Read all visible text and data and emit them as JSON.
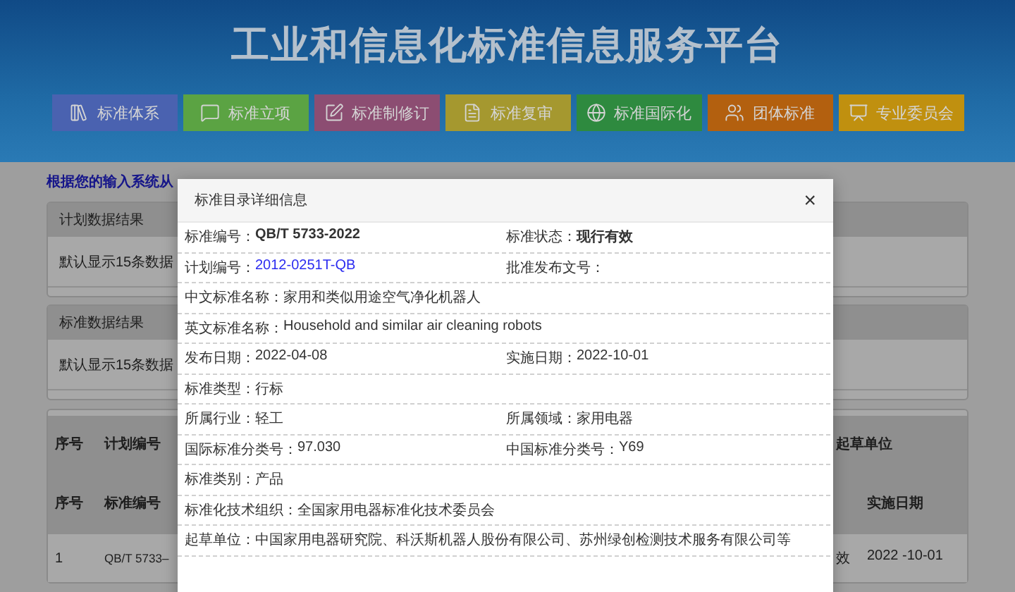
{
  "header": {
    "title": "工业和信息化标准信息服务平台"
  },
  "nav": [
    {
      "label": "标准体系",
      "color": "#4a62b0"
    },
    {
      "label": "标准立项",
      "color": "#5ba343"
    },
    {
      "label": "标准制修订",
      "color": "#8c4d72"
    },
    {
      "label": "标准复审",
      "color": "#a5982f"
    },
    {
      "label": "标准国际化",
      "color": "#2e8a3f"
    },
    {
      "label": "团体标准",
      "color": "#b3600f"
    },
    {
      "label": "专业委员会",
      "color": "#c0900f"
    }
  ],
  "intro": "根据您的输入系统从",
  "panels": [
    {
      "title": "计划数据结果",
      "note": "默认显示15条数据"
    },
    {
      "title": "标准数据结果",
      "note": "默认显示15条数据"
    }
  ],
  "plan_table": {
    "columns": [
      "序号",
      "计划编号",
      "起草单位"
    ]
  },
  "standard_table": {
    "columns": [
      "序号",
      "标准编号",
      "",
      "实施日期"
    ],
    "rows": [
      {
        "cells": [
          "1",
          "QB/T 5733–",
          "效",
          "2022 -10-01"
        ]
      }
    ]
  },
  "modal": {
    "title": "标准目录详细信息",
    "close": "×",
    "rows": [
      {
        "cells": [
          {
            "label": "标准编号：",
            "value": "QB/T 5733-2022",
            "kind": "emphasis"
          },
          {
            "label": "标准状态：",
            "value": "现行有效",
            "kind": "emphasis"
          }
        ]
      },
      {
        "cells": [
          {
            "label": "计划编号：",
            "value": "2012-0251T-QB",
            "kind": "link"
          },
          {
            "label": "批准发布文号："
          }
        ]
      },
      {
        "cells": [
          {
            "label": "中文标准名称：",
            "value": "家用和类似用途空气净化机器人",
            "kind": "plain"
          }
        ]
      },
      {
        "cells": [
          {
            "label": "英文标准名称：",
            "value": "Household and similar air cleaning robots",
            "kind": "plain"
          }
        ]
      },
      {
        "cells": [
          {
            "label": "发布日期：",
            "value": "2022-04-08",
            "kind": "plain"
          },
          {
            "label": "实施日期：",
            "value": "2022-10-01",
            "kind": "plain"
          }
        ]
      },
      {
        "cells": [
          {
            "label": "标准类型：",
            "value": "行标",
            "kind": "plain"
          }
        ]
      },
      {
        "cells": [
          {
            "label": "所属行业：",
            "value": "轻工",
            "kind": "plain"
          },
          {
            "label": "所属领域：",
            "value": "家用电器",
            "kind": "plain"
          }
        ]
      },
      {
        "cells": [
          {
            "label": "国际标准分类号：",
            "value": "97.030",
            "kind": "plain"
          },
          {
            "label": "中国标准分类号：",
            "value": "Y69",
            "kind": "plain"
          }
        ]
      },
      {
        "cells": [
          {
            "label": "标准类别：",
            "value": "产品",
            "kind": "plain"
          }
        ]
      },
      {
        "cells": [
          {
            "label": "标准化技术组织：",
            "value": "全国家用电器标准化技术委员会",
            "kind": "plain"
          }
        ]
      },
      {
        "cells": [
          {
            "label": "起草单位：",
            "value": "中国家用电器研究院、科沃斯机器人股份有限公司、苏州绿创检测技术服务有限公司等",
            "kind": "plain"
          }
        ]
      }
    ]
  }
}
